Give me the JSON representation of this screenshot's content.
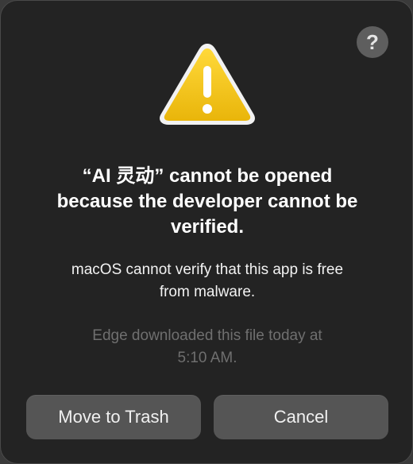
{
  "dialog": {
    "help_symbol": "?",
    "icon": "warning-triangle-icon",
    "title_lines": [
      "“AI 灵动” cannot be opened",
      "because the developer cannot be",
      "verified."
    ],
    "message_lines": [
      "macOS cannot verify that this app is free",
      "from malware."
    ],
    "note_lines": [
      "Edge downloaded this file today at",
      "5:10 AM."
    ],
    "buttons": {
      "move_to_trash": "Move to Trash",
      "cancel": "Cancel"
    }
  },
  "colors": {
    "background": "#232323",
    "button": "#555555",
    "warning_yellow": "#f5c518",
    "muted_text": "#6f6f6f"
  }
}
